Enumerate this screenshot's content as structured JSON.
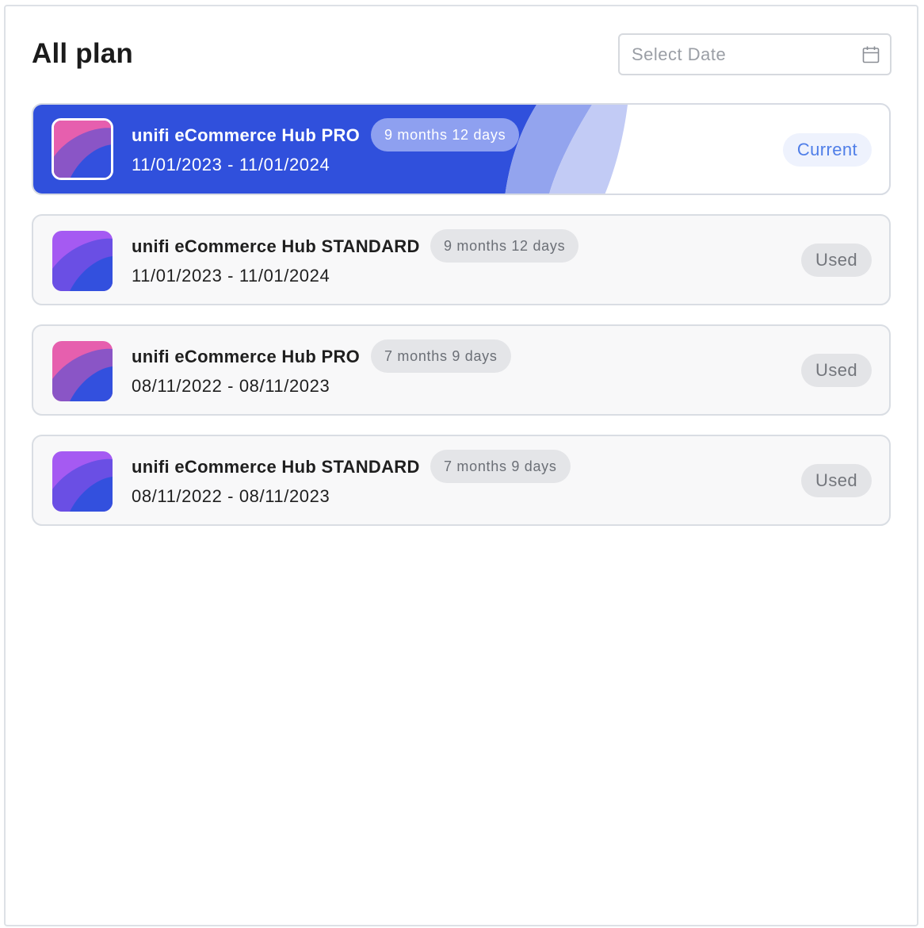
{
  "page": {
    "title": "All plan",
    "date_placeholder": "Select Date"
  },
  "colors": {
    "accent": "#3050dc",
    "used_badge_bg": "#e3e4e7",
    "current_badge_text": "#4f7ee8"
  },
  "plans": [
    {
      "name": "unifi eCommerce Hub PRO",
      "duration": "9 months 12 days",
      "dates": "11/01/2023 - 11/01/2024",
      "status": "Current",
      "tier": "pro",
      "icon": "pro-plan-icon"
    },
    {
      "name": "unifi eCommerce Hub STANDARD",
      "duration": "9 months 12 days",
      "dates": "11/01/2023 - 11/01/2024",
      "status": "Used",
      "tier": "standard",
      "icon": "standard-plan-icon"
    },
    {
      "name": "unifi eCommerce Hub PRO",
      "duration": "7 months 9 days",
      "dates": "08/11/2022 - 08/11/2023",
      "status": "Used",
      "tier": "pro",
      "icon": "pro-plan-icon"
    },
    {
      "name": "unifi eCommerce Hub STANDARD",
      "duration": "7 months 9 days",
      "dates": "08/11/2022 - 08/11/2023",
      "status": "Used",
      "tier": "standard",
      "icon": "standard-plan-icon"
    }
  ]
}
